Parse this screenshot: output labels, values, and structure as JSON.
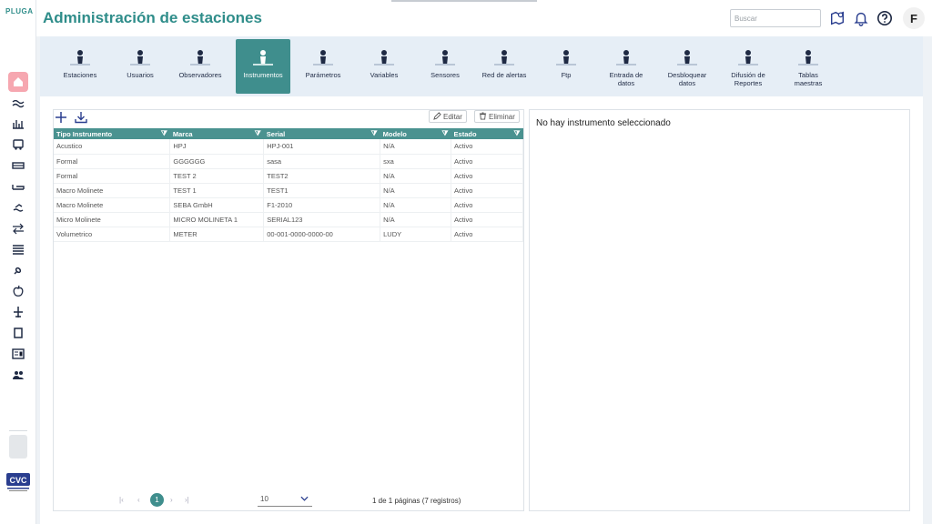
{
  "app": {
    "logo": "PLUGA",
    "title": "Administración de estaciones"
  },
  "header": {
    "search_placeholder": "Buscar",
    "user_initial": "F",
    "accent": "#2f8d8a"
  },
  "sidebar": {
    "items": [
      {
        "icon": "house-icon",
        "active": true
      },
      {
        "icon": "wave-icon"
      },
      {
        "icon": "bars-icon"
      },
      {
        "icon": "bus-icon"
      },
      {
        "icon": "tray-icon"
      },
      {
        "icon": "bed-icon"
      },
      {
        "icon": "swimmer-icon"
      },
      {
        "icon": "arrows-icon"
      },
      {
        "icon": "list-icon"
      },
      {
        "icon": "link-icon"
      },
      {
        "icon": "apple-icon"
      },
      {
        "icon": "plane-icon"
      },
      {
        "icon": "book-icon"
      },
      {
        "icon": "news-icon"
      },
      {
        "icon": "group-icon"
      }
    ],
    "brand_logo": "CVC"
  },
  "modules": [
    {
      "label": "Estaciones",
      "icon": "station-icon"
    },
    {
      "label": "Usuarios",
      "icon": "users-icon"
    },
    {
      "label": "Observadores",
      "icon": "observer-icon"
    },
    {
      "label": "Instrumentos",
      "icon": "instrument-icon",
      "active": true
    },
    {
      "label": "Parámetros",
      "icon": "parameters-icon"
    },
    {
      "label": "Variables",
      "icon": "variables-icon"
    },
    {
      "label": "Sensores",
      "icon": "sensors-icon"
    },
    {
      "label": "Red de alertas",
      "icon": "alerts-icon"
    },
    {
      "label": "Ftp",
      "icon": "ftp-icon"
    },
    {
      "label": "Entrada de\ndatos",
      "icon": "data-entry-icon"
    },
    {
      "label": "Desbloquear\ndatos",
      "icon": "unlock-icon"
    },
    {
      "label": "Difusión de\nReportes",
      "icon": "reports-icon"
    },
    {
      "label": "Tablas\nmaestras",
      "icon": "tables-icon"
    }
  ],
  "toolbar": {
    "add_icon": "plus-icon",
    "download_icon": "download-icon",
    "edit_label": "Editar",
    "delete_label": "Eliminar"
  },
  "table": {
    "columns": [
      "Tipo Instrumento",
      "Marca",
      "Serial",
      "Modelo",
      "Estado"
    ],
    "rows": [
      [
        "Acustico",
        "HPJ",
        "HPJ-001",
        "N/A",
        "Activo"
      ],
      [
        "Formal",
        "GGGGGG",
        "sasa",
        "sxa",
        "Activo"
      ],
      [
        "Formal",
        "TEST 2",
        "TEST2",
        "N/A",
        "Activo"
      ],
      [
        "Macro Molinete",
        "TEST 1",
        "TEST1",
        "N/A",
        "Activo"
      ],
      [
        "Macro Molinete",
        "SEBA GmbH",
        "F1-2010",
        "N/A",
        "Activo"
      ],
      [
        "Micro Molinete",
        "MICRO MOLINETA 1",
        "SERIAL123",
        "N/A",
        "Activo"
      ],
      [
        "Volumetrico",
        "METER",
        "00-001-0000-0000-00",
        "LUDY",
        "Activo"
      ]
    ]
  },
  "pager": {
    "current_page": "1",
    "page_size": "10",
    "info": "1 de 1 páginas (7 registros)"
  },
  "detail": {
    "empty_text": "No hay instrumento seleccionado"
  }
}
